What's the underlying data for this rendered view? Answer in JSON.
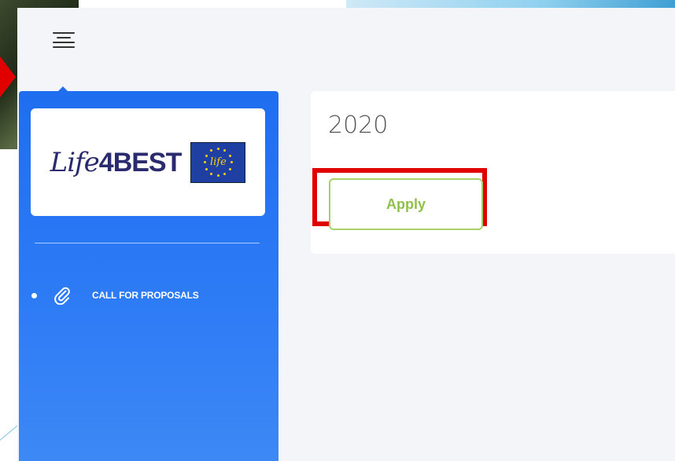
{
  "app": {
    "logo_text_script": "Life",
    "logo_text_main": "4BEST",
    "logo_flag_mark": "life"
  },
  "sidebar": {
    "items": [
      {
        "label": "CALL FOR PROPOSALS",
        "icon": "paperclip-icon"
      }
    ]
  },
  "main": {
    "year": "2020",
    "apply_label": "Apply"
  },
  "colors": {
    "sidebar": "#1f6ef0",
    "apply_text": "#8fc14a",
    "apply_border": "#a8d06a",
    "highlight": "#e10000"
  }
}
